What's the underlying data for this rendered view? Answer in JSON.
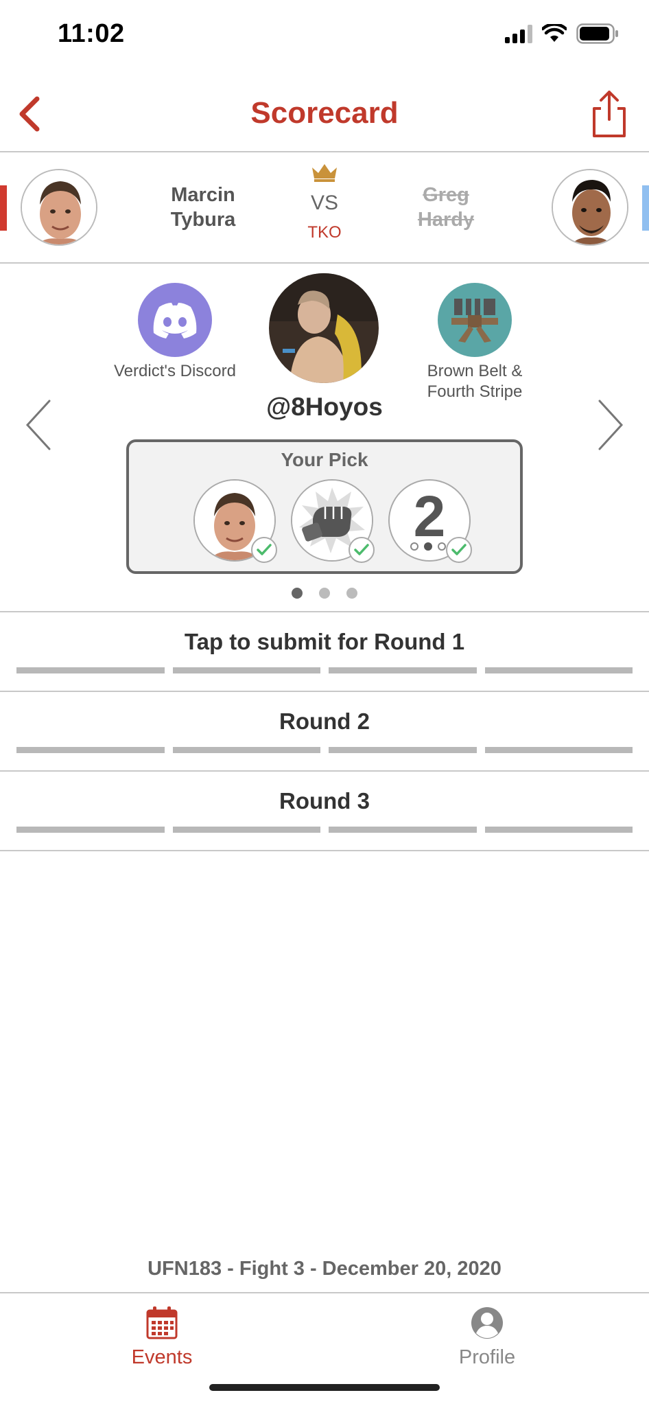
{
  "status_bar": {
    "time": "11:02"
  },
  "header": {
    "title": "Scorecard"
  },
  "fight": {
    "red_corner": {
      "first": "Marcin",
      "last": "Tybura"
    },
    "blue_corner": {
      "first": "Greg",
      "last": "Hardy"
    },
    "vs": "VS",
    "result": "TKO"
  },
  "profile": {
    "left_badge": "Verdict's Discord",
    "right_badge_line1": "Brown Belt &",
    "right_badge_line2": "Fourth Stripe",
    "username": "@8Hoyos",
    "pick_title": "Your Pick",
    "pick_round": "2"
  },
  "rounds": [
    {
      "label": "Tap to submit for Round 1"
    },
    {
      "label": "Round 2"
    },
    {
      "label": "Round 3"
    }
  ],
  "footer": {
    "event_info": "UFN183 - Fight 3 - December 20, 2020"
  },
  "tabs": {
    "events": "Events",
    "profile": "Profile"
  },
  "colors": {
    "accent": "#c0392b",
    "red_corner": "#d03a2f",
    "blue_corner": "#90bff0",
    "discord": "#8c82dc",
    "belt_bg": "#5aa6a6",
    "check": "#4cbb6c"
  }
}
